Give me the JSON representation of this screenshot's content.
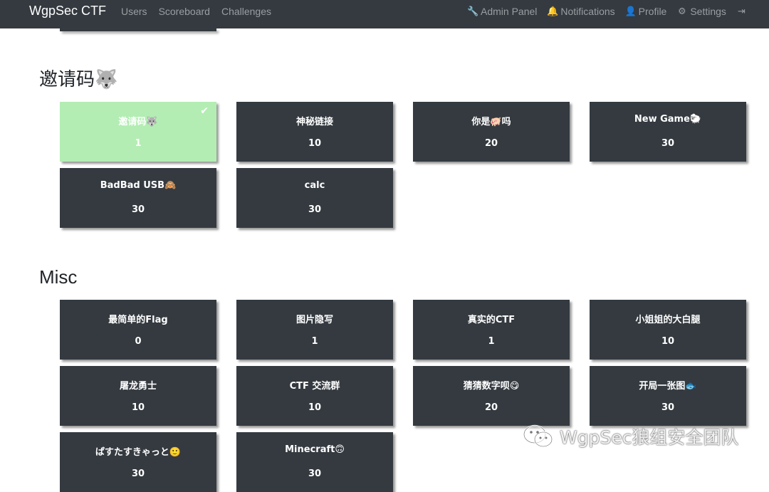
{
  "navbar": {
    "brand": "WgpSec CTF",
    "left_links": [
      "Users",
      "Scoreboard",
      "Challenges"
    ],
    "right_links": [
      {
        "icon": "wrench-icon",
        "glyph": "🔧",
        "label": "Admin Panel"
      },
      {
        "icon": "bell-icon",
        "glyph": "🔔",
        "label": "Notifications"
      },
      {
        "icon": "user-circle-icon",
        "glyph": "👤",
        "label": "Profile"
      },
      {
        "icon": "cogs-icon",
        "glyph": "⚙",
        "label": "Settings"
      },
      {
        "icon": "logout-icon",
        "glyph": "⇥",
        "label": ""
      }
    ]
  },
  "categories": [
    {
      "title": "邀请码🐺",
      "challenges": [
        {
          "name": "邀请码🐺",
          "value": "1",
          "solved": true
        },
        {
          "name": "神秘链接",
          "value": "10",
          "solved": false
        },
        {
          "name": "你是🐖吗",
          "value": "20",
          "solved": false
        },
        {
          "name": "New Game🐑",
          "value": "30",
          "solved": false
        },
        {
          "name": "BadBad USB🙈",
          "value": "30",
          "solved": false
        },
        {
          "name": "calc",
          "value": "30",
          "solved": false
        }
      ]
    },
    {
      "title": "Misc",
      "challenges": [
        {
          "name": "最简单的Flag",
          "value": "0",
          "solved": false
        },
        {
          "name": "图片隐写",
          "value": "1",
          "solved": false
        },
        {
          "name": "真实的CTF",
          "value": "1",
          "solved": false
        },
        {
          "name": "小姐姐的大白腿",
          "value": "10",
          "solved": false
        },
        {
          "name": "屠龙勇士",
          "value": "10",
          "solved": false
        },
        {
          "name": "CTF 交流群",
          "value": "10",
          "solved": false
        },
        {
          "name": "猜猜数字呗😋",
          "value": "20",
          "solved": false
        },
        {
          "name": "开局一张图🐟",
          "value": "30",
          "solved": false
        },
        {
          "name": "ぱすたすきゃっと🙂",
          "value": "30",
          "solved": false
        },
        {
          "name": "Minecraft🙃",
          "value": "30",
          "solved": false
        }
      ]
    }
  ],
  "check_glyph": "✔",
  "watermark": "WgpSec狼组安全团队",
  "colors": {
    "navbar_bg": "#343a40",
    "card_bg": "#343a40",
    "solved_bg": "#b3edb3",
    "nav_text": "#9a9ea3"
  }
}
